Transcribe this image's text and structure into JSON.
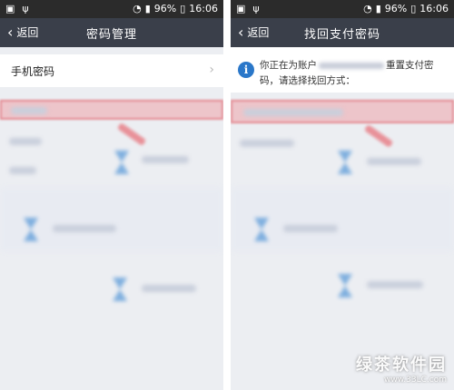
{
  "status_bar": {
    "battery": "96%",
    "time": "16:06"
  },
  "left_screen": {
    "back_label": "返回",
    "title": "密码管理",
    "items": [
      {
        "label": "手机密码"
      }
    ]
  },
  "right_screen": {
    "back_label": "返回",
    "title": "找回支付密码",
    "info_prefix": "你正在为账户",
    "info_suffix": "重置支付密码，请选择找回方式："
  },
  "watermark": {
    "site_name": "绿茶软件园",
    "url": "www.33LC.com"
  },
  "colors": {
    "status_bar": "#2b2b2b",
    "app_bar": "#3a3f4a",
    "info_icon": "#2a77c9",
    "highlight": "#f07882"
  }
}
